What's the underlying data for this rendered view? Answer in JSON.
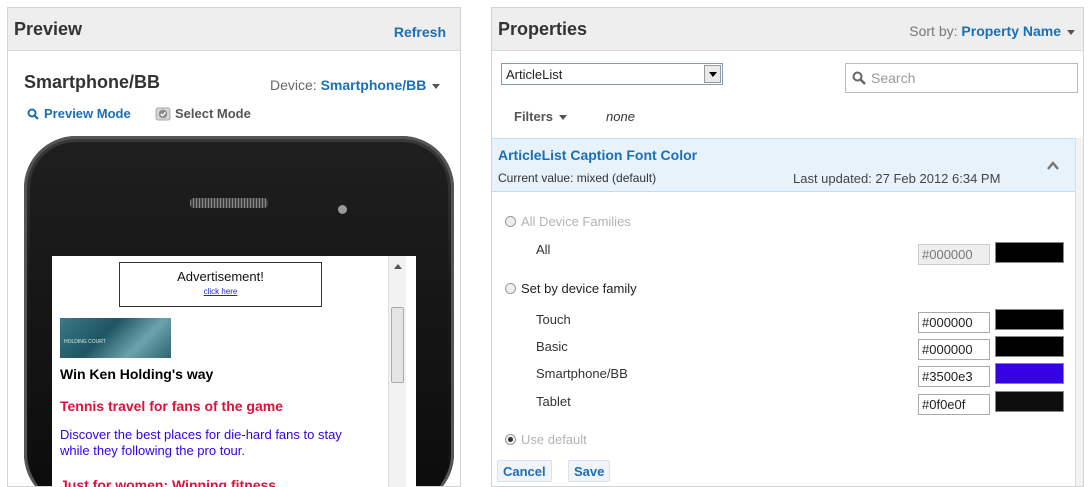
{
  "preview": {
    "title": "Preview",
    "refresh_label": "Refresh",
    "device_name": "Smartphone/BB",
    "device_label": "Device:",
    "device_value": "Smartphone/BB",
    "preview_mode_label": "Preview Mode",
    "select_mode_label": "Select Mode",
    "screen": {
      "ad_title": "Advertisement!",
      "ad_link": "click here",
      "thumb_text": "HOLDING COURT",
      "article_title": "Win Ken Holding's way",
      "article_heading": "Tennis travel for fans of the game",
      "article_body": "Discover the best places for die-hard fans to stay while they following the pro tour.",
      "article_next": "Just for women: Winning fitness"
    }
  },
  "properties": {
    "title": "Properties",
    "sort_label": "Sort by:",
    "sort_value": "Property Name",
    "object_select_value": "ArticleList",
    "search_placeholder": "Search",
    "filters_label": "Filters",
    "filters_value": "none",
    "property": {
      "title": "ArticleList Caption Font Color",
      "current_value": "Current value: mixed (default)",
      "last_updated": "Last updated: 27 Feb 2012 6:34 PM",
      "all_families_label": "All Device Families",
      "all_label": "All",
      "all_hex": "#000000",
      "all_color": "#000000",
      "by_family_label": "Set by device family",
      "families": [
        {
          "name": "Touch",
          "hex": "#000000",
          "color": "#000000"
        },
        {
          "name": "Basic",
          "hex": "#000000",
          "color": "#000000"
        },
        {
          "name": "Smartphone/BB",
          "hex": "#3500e3",
          "color": "#3500e3"
        },
        {
          "name": "Tablet",
          "hex": "#0f0e0f",
          "color": "#0f0e0f"
        }
      ],
      "use_default_label": "Use default"
    },
    "cancel_label": "Cancel",
    "save_label": "Save"
  }
}
